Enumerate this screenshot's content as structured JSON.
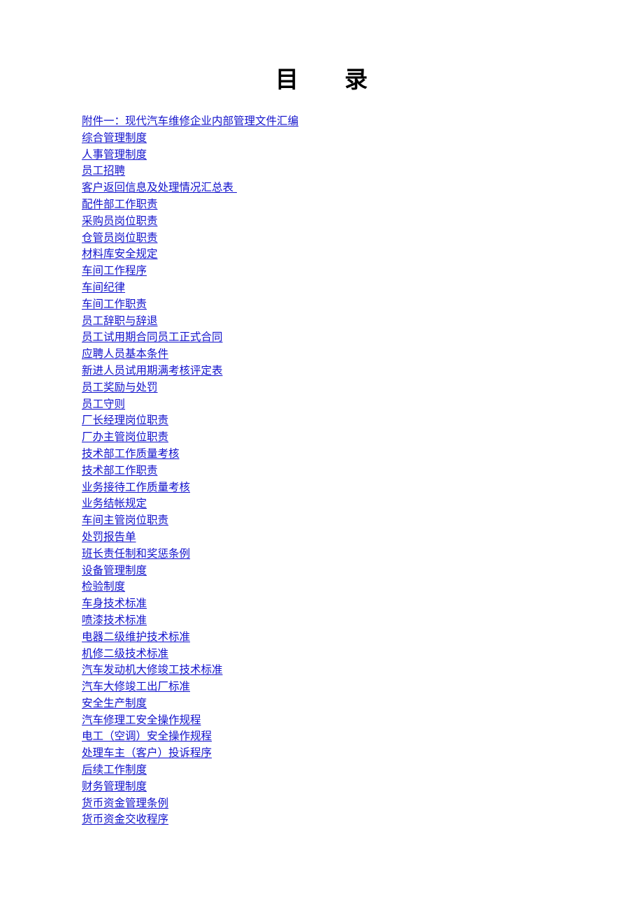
{
  "document": {
    "title": "目　　录",
    "title_plain": "目 录",
    "link_color": "#1111cc",
    "title_color": "#000000",
    "background_color": "#ffffff"
  },
  "toc": {
    "entries": [
      {
        "label": "附件一：现代汽车维修企业内部管理文件汇编"
      },
      {
        "label": "综合管理制度"
      },
      {
        "label": "人事管理制度"
      },
      {
        "label": "员工招聘"
      },
      {
        "label": "客户返回信息及处理情况汇总表 "
      },
      {
        "label": "配件部工作职责"
      },
      {
        "label": "采购员岗位职责"
      },
      {
        "label": "仓管员岗位职责"
      },
      {
        "label": "材料库安全规定"
      },
      {
        "label": "车间工作程序"
      },
      {
        "label": "车间纪律"
      },
      {
        "label": "车间工作职责"
      },
      {
        "label": "员工辞职与辞退"
      },
      {
        "label": "员工试用期合同员工正式合同"
      },
      {
        "label": "应聘人员基本条件"
      },
      {
        "label": "新进人员试用期满考核评定表"
      },
      {
        "label": "员工奖励与处罚"
      },
      {
        "label": "员工守则"
      },
      {
        "label": "厂长经理岗位职责"
      },
      {
        "label": "厂办主管岗位职责"
      },
      {
        "label": "技术部工作质量考核"
      },
      {
        "label": "技术部工作职责"
      },
      {
        "label": "业务接待工作质量考核"
      },
      {
        "label": "业务结帐规定"
      },
      {
        "label": "车间主管岗位职责"
      },
      {
        "label": "处罚报告单"
      },
      {
        "label": "班长责任制和奖惩条例"
      },
      {
        "label": "设备管理制度"
      },
      {
        "label": "检验制度"
      },
      {
        "label": "车身技术标准"
      },
      {
        "label": "喷漆技术标准"
      },
      {
        "label": "电器二级维护技术标准"
      },
      {
        "label": "机修二级技术标准"
      },
      {
        "label": "汽车发动机大修竣工技术标准"
      },
      {
        "label": "汽车大修竣工出厂标准"
      },
      {
        "label": "安全生产制度"
      },
      {
        "label": "汽车修理工安全操作规程"
      },
      {
        "label": "电工（空调）安全操作规程"
      },
      {
        "label": "处理车主（客户）投诉程序"
      },
      {
        "label": "后续工作制度"
      },
      {
        "label": "财务管理制度"
      },
      {
        "label": "货币资金管理条例"
      },
      {
        "label": "货币资金交收程序"
      }
    ]
  }
}
